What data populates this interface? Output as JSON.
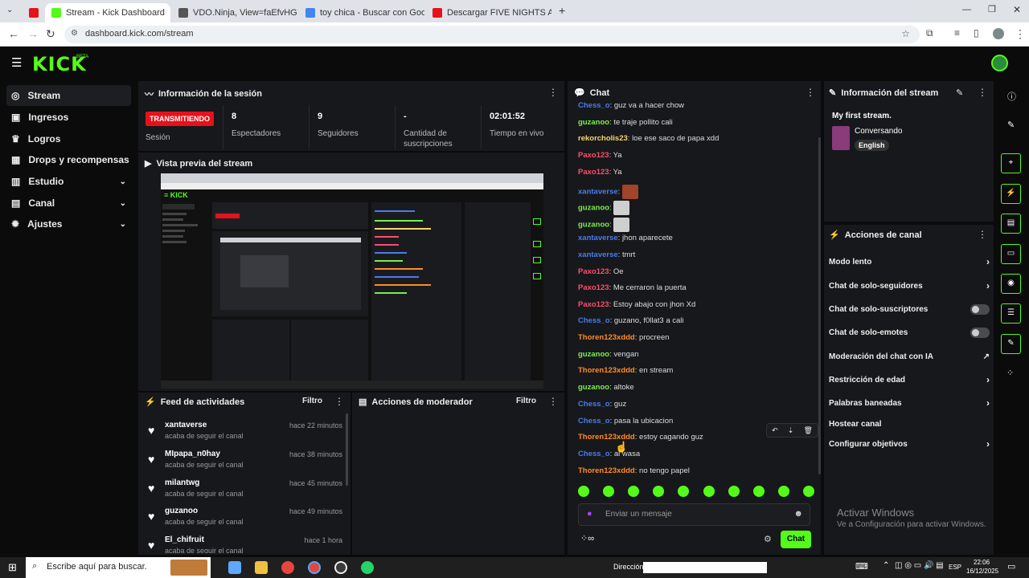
{
  "browser": {
    "tabs": [
      {
        "title": "",
        "color": "#e5121b"
      },
      {
        "title": "Stream - Kick Dashboard",
        "color": "#53fc18"
      },
      {
        "title": "VDO.Ninja, View=faEfvHG",
        "color": "#555555"
      },
      {
        "title": "toy chica - Buscar con Google",
        "color": "#4285f4"
      },
      {
        "title": "Descargar FIVE NIGHTS AT FRE",
        "color": "#e5121b"
      }
    ],
    "url": "dashboard.kick.com/stream"
  },
  "header": {
    "logo": "KICK",
    "beta": "BETA"
  },
  "sidebar": {
    "items": [
      {
        "label": "Stream",
        "icon": "broadcast-icon",
        "glyph": "◎"
      },
      {
        "label": "Ingresos",
        "icon": "wallet-icon",
        "glyph": "▣"
      },
      {
        "label": "Logros",
        "icon": "trophy-icon",
        "glyph": "♛"
      },
      {
        "label": "Drops y recompensas",
        "icon": "gift-icon",
        "glyph": "▦"
      },
      {
        "label": "Estudio",
        "icon": "studio-icon",
        "glyph": "▥"
      },
      {
        "label": "Canal",
        "icon": "channel-icon",
        "glyph": "▤"
      },
      {
        "label": "Ajustes",
        "icon": "gear-icon",
        "glyph": "✹"
      }
    ]
  },
  "session": {
    "title": "Información de la sesión",
    "live_badge": "TRANSMITIENDO",
    "session_label": "Sesión",
    "stats": [
      {
        "value": "8",
        "label": "Espectadores"
      },
      {
        "value": "9",
        "label": "Seguidores"
      },
      {
        "value": "-",
        "label": "Cantidad de suscripciones"
      },
      {
        "value": "02:01:52",
        "label": "Tiempo en vivo"
      }
    ]
  },
  "preview": {
    "title": "Vista previa del stream"
  },
  "feed": {
    "title": "Feed de actividades",
    "filter": "Filtro",
    "items": [
      {
        "name": "xantaverse",
        "sub": "acaba de seguir el canal",
        "time": "hace 22 minutos"
      },
      {
        "name": "MIpapa_n0hay",
        "sub": "acaba de seguir el canal",
        "time": "hace 38 minutos"
      },
      {
        "name": "milantwg",
        "sub": "acaba de seguir el canal",
        "time": "hace 45 minutos"
      },
      {
        "name": "guzanoo",
        "sub": "acaba de seguir el canal",
        "time": "hace 49 minutos"
      },
      {
        "name": "El_chifruit",
        "sub": "acaba de seguir el canal",
        "time": "hace 1 hora"
      }
    ]
  },
  "mod": {
    "title": "Acciones de moderador",
    "filter": "Filtro"
  },
  "chat": {
    "title": "Chat",
    "messages": [
      {
        "user": "Chess_o",
        "color": "#4b7bec",
        "text": "guz va a hacer chow"
      },
      {
        "user": "guzanoo",
        "color": "#7bed4f",
        "text": "te traje pollito cali"
      },
      {
        "user": "rekorcholis23",
        "color": "#f5d76e",
        "text": "loe ese saco de papa xdd"
      },
      {
        "user": "Paxo123",
        "color": "#ff4d6d",
        "text": "Ya"
      },
      {
        "user": "Paxo123",
        "color": "#ff4d6d",
        "text": "Ya"
      },
      {
        "user": "xantaverse",
        "color": "#4b7bec",
        "text": "",
        "emote": "#a0442a"
      },
      {
        "user": "guzanoo",
        "color": "#7bed4f",
        "text": "",
        "emote": "#cfcfcf"
      },
      {
        "user": "guzanoo",
        "color": "#7bed4f",
        "text": "",
        "emote": "#cfcfcf"
      },
      {
        "user": "xantaverse",
        "color": "#4b7bec",
        "text": "jhon aparecete"
      },
      {
        "user": "xantaverse",
        "color": "#4b7bec",
        "text": "tmrt"
      },
      {
        "user": "Paxo123",
        "color": "#ff4d6d",
        "text": "Oe"
      },
      {
        "user": "Paxo123",
        "color": "#ff4d6d",
        "text": "Me cerraron la puerta"
      },
      {
        "user": "Paxo123",
        "color": "#ff4d6d",
        "text": "Estoy abajo con jhon Xd"
      },
      {
        "user": "Chess_o",
        "color": "#4b7bec",
        "text": "guzano, f0llat3 a cali"
      },
      {
        "user": "Thoren123xddd",
        "color": "#ff8c2a",
        "text": "procreen"
      },
      {
        "user": "guzanoo",
        "color": "#7bed4f",
        "text": "vengan"
      },
      {
        "user": "Thoren123xddd",
        "color": "#ff8c2a",
        "text": "en stream"
      },
      {
        "user": "guzanoo",
        "color": "#7bed4f",
        "text": "altoke"
      },
      {
        "user": "Chess_o",
        "color": "#4b7bec",
        "text": "guz"
      },
      {
        "user": "Chess_o",
        "color": "#4b7bec",
        "text": "pasa la ubicacion"
      },
      {
        "user": "Thoren123xddd",
        "color": "#ff8c2a",
        "text": "estoy cagando guz"
      },
      {
        "user": "Chess_o",
        "color": "#4b7bec",
        "text": "al wasa"
      },
      {
        "user": "Thoren123xddd",
        "color": "#ff8c2a",
        "text": "no tengo papel"
      }
    ],
    "input_placeholder": "Enviar un mensaje",
    "send_label": "Chat"
  },
  "stream_info": {
    "title": "Información del stream",
    "stream_title": "My first stream.",
    "category": "Conversando",
    "language": "English"
  },
  "channel_actions": {
    "title": "Acciones de canal",
    "items": [
      {
        "label": "Modo lento",
        "control": "arrow"
      },
      {
        "label": "Chat de solo-seguidores",
        "control": "arrow"
      },
      {
        "label": "Chat de solo-suscriptores",
        "control": "toggle"
      },
      {
        "label": "Chat de solo-emotes",
        "control": "toggle"
      },
      {
        "label": "Moderación del chat con IA",
        "control": "external"
      },
      {
        "label": "Restricción de edad",
        "control": "arrow"
      },
      {
        "label": "Palabras baneadas",
        "control": "arrow"
      },
      {
        "label": "Hostear canal",
        "control": "none"
      },
      {
        "label": "Configurar objetivos",
        "control": "arrow"
      }
    ]
  },
  "watermark": {
    "line1": "Activar Windows",
    "line2": "Ve a Configuración para activar Windows."
  },
  "taskbar": {
    "search_placeholder": "Escribe aquí para buscar.",
    "address_label": "Dirección",
    "lang": "ESP",
    "time": "22:06",
    "date": "16/12/2025"
  }
}
